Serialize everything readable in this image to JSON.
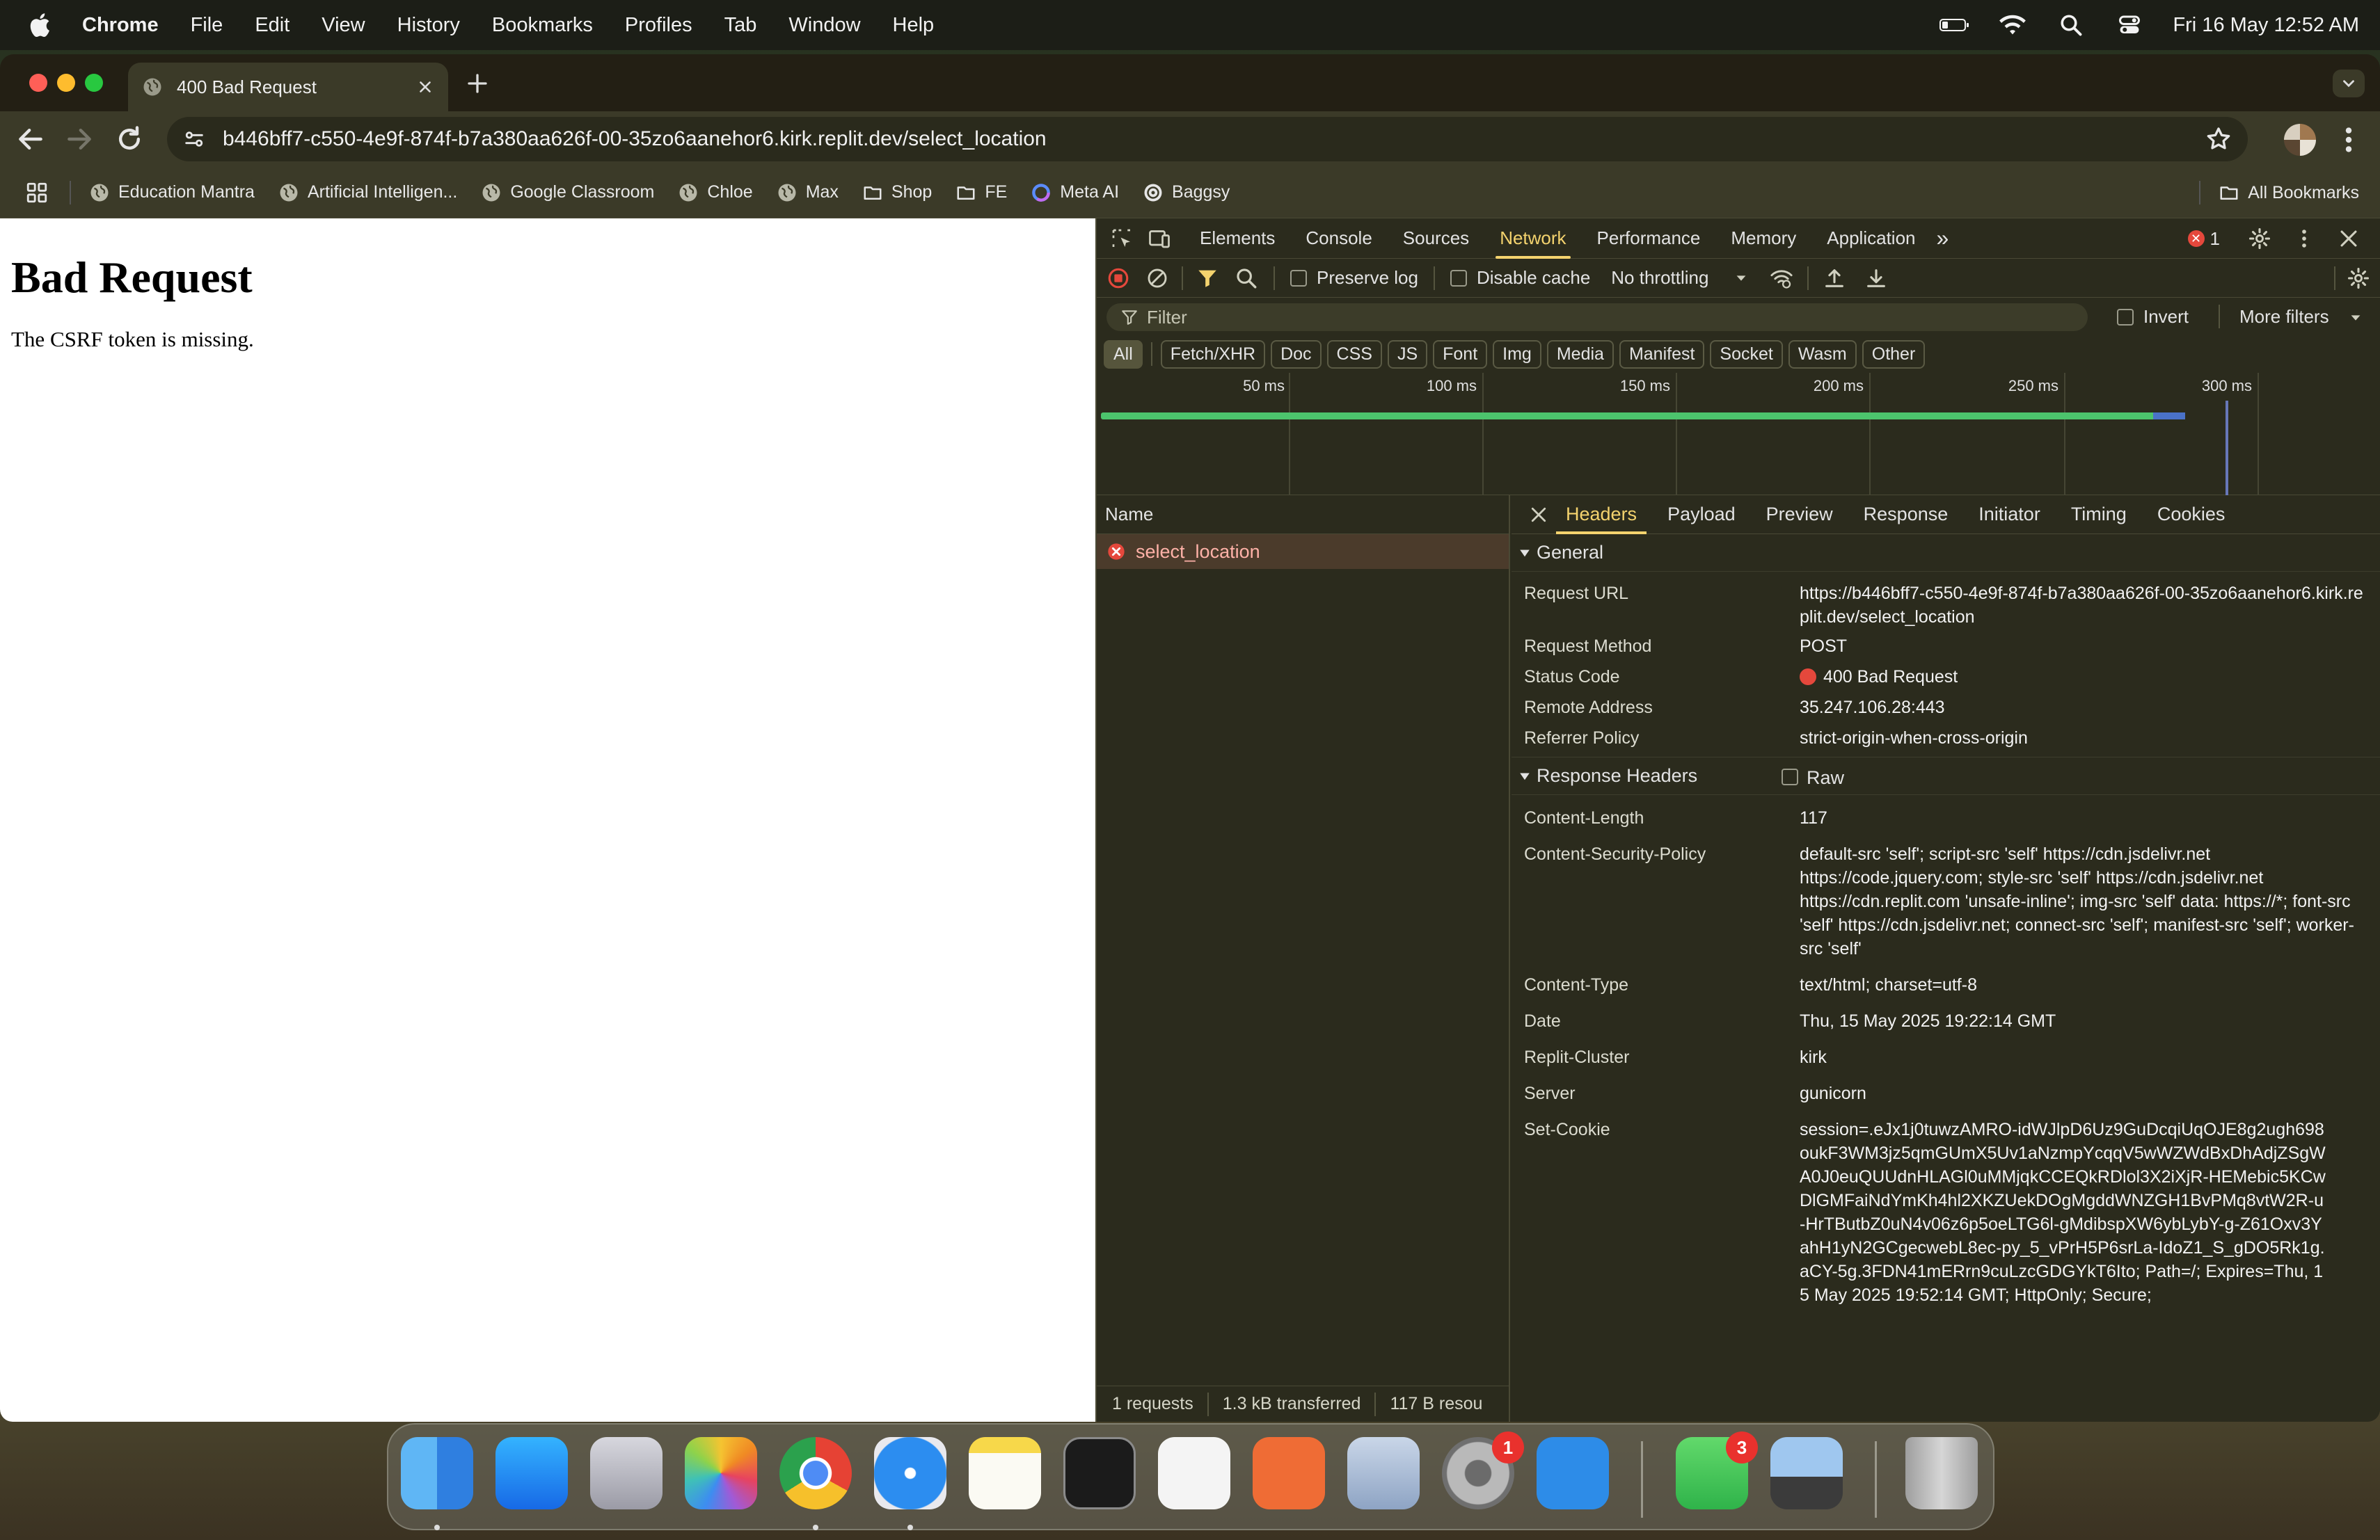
{
  "menubar": {
    "app": "Chrome",
    "items": [
      "File",
      "Edit",
      "View",
      "History",
      "Bookmarks",
      "Profiles",
      "Tab",
      "Window",
      "Help"
    ],
    "clock": "Fri 16 May  12:52 AM"
  },
  "browser": {
    "tab_title": "400 Bad Request",
    "url": "b446bff7-c550-4e9f-874f-b7a380aa626f-00-35zo6aanehor6.kirk.replit.dev/select_location",
    "bookmarks": [
      {
        "label": "Education Mantra",
        "icon": "globe-icon"
      },
      {
        "label": "Artificial Intelligen...",
        "icon": "globe-icon"
      },
      {
        "label": "Google Classroom",
        "icon": "globe-icon"
      },
      {
        "label": "Chloe",
        "icon": "globe-icon"
      },
      {
        "label": "Max",
        "icon": "globe-icon"
      },
      {
        "label": "Shop",
        "icon": "folder-icon"
      },
      {
        "label": "FE",
        "icon": "folder-icon"
      },
      {
        "label": "Meta AI",
        "icon": "meta-ai-icon"
      },
      {
        "label": "Baggsy",
        "icon": "globe-icon"
      }
    ],
    "all_bookmarks": "All Bookmarks"
  },
  "page": {
    "heading": "Bad Request",
    "message": "The CSRF token is missing."
  },
  "devtools": {
    "tabs": [
      "Elements",
      "Console",
      "Sources",
      "Network",
      "Performance",
      "Memory",
      "Application"
    ],
    "active_tab": "Network",
    "more_tabs": "»",
    "error_count": "1",
    "network_toolbar": {
      "preserve_log": "Preserve log",
      "disable_cache": "Disable cache",
      "throttling": "No throttling"
    },
    "filter": {
      "placeholder": "Filter",
      "invert": "Invert",
      "more_filters": "More filters"
    },
    "type_filters": [
      "All",
      "Fetch/XHR",
      "Doc",
      "CSS",
      "JS",
      "Font",
      "Img",
      "Media",
      "Manifest",
      "Socket",
      "Wasm",
      "Other"
    ],
    "timeline": {
      "ticks": [
        "50 ms",
        "100 ms",
        "150 ms",
        "200 ms",
        "250 ms",
        "300 ms"
      ],
      "request_duration_fraction": 0.92
    },
    "requests": {
      "column_name": "Name",
      "rows": [
        {
          "name": "select_location",
          "status": "error"
        }
      ],
      "summary": {
        "requests": "1 requests",
        "transferred": "1.3 kB transferred",
        "resources": "117 B resou"
      }
    },
    "detail_tabs": [
      "Headers",
      "Payload",
      "Preview",
      "Response",
      "Initiator",
      "Timing",
      "Cookies"
    ],
    "general": {
      "title": "General",
      "rows": [
        {
          "key": "Request URL",
          "value": "https://b446bff7-c550-4e9f-874f-b7a380aa626f-00-35zo6aanehor6.kirk.replit.dev/select_location"
        },
        {
          "key": "Request Method",
          "value": "POST"
        },
        {
          "key": "Status Code",
          "value": "400 Bad Request"
        },
        {
          "key": "Remote Address",
          "value": "35.247.106.28:443"
        },
        {
          "key": "Referrer Policy",
          "value": "strict-origin-when-cross-origin"
        }
      ]
    },
    "response_headers": {
      "title": "Response Headers",
      "raw_label": "Raw",
      "rows": [
        {
          "key": "Content-Length",
          "value": "117"
        },
        {
          "key": "Content-Security-Policy",
          "value": "default-src 'self'; script-src 'self' https://cdn.jsdelivr.net https://code.jquery.com; style-src 'self' https://cdn.jsdelivr.net https://cdn.replit.com 'unsafe-inline'; img-src 'self' data: https://*; font-src 'self' https://cdn.jsdelivr.net; connect-src 'self'; manifest-src 'self'; worker-src 'self'"
        },
        {
          "key": "Content-Type",
          "value": "text/html; charset=utf-8"
        },
        {
          "key": "Date",
          "value": "Thu, 15 May 2025 19:22:14 GMT"
        },
        {
          "key": "Replit-Cluster",
          "value": "kirk"
        },
        {
          "key": "Server",
          "value": "gunicorn"
        },
        {
          "key": "Set-Cookie",
          "value": "session=.eJx1j0tuwzAMRO-idWJlpD6Uz9GuDcqiUqOJE8g2ugh698oukF3WM3jz5qmGUmX5Uv1aNzmpYcqqV5wWZWdBxDhAdjZSgWA0J0euQUUdnHLAGl0uMMjqkCCEQkRDlol3X2iXjR-HEMebic5KCwDlGMFaiNdYmKh4hl2XKZUekDOgMgddWNZGH1BvPMq8vtW2R-u-HrTButbZ0uN4v06z6p5oeLTG6l-gMdibspXW6ybLybY-g-Z61Oxv3YahH1yN2GCgecwebL8ec-py_5_vPrH5P6srLa-IdoZ1_S_gDO5Rk1g.aCY-5g.3FDN41mERrn9cuLzcGDGYkT6Ito; Path=/; Expires=Thu, 15 May 2025 19:52:14 GMT; HttpOnly; Secure;"
        }
      ]
    }
  },
  "dock": {
    "apps": [
      "finder-icon",
      "app-store-icon",
      "launchpad-icon",
      "photos-icon",
      "chrome-icon",
      "safari-icon",
      "notes-icon",
      "terminal-icon",
      "vscode-icon",
      "postman-icon",
      "postgres-icon",
      "system-settings-icon",
      "docker-icon",
      "facetime-icon",
      "preview-icon",
      "trash-icon"
    ],
    "system_settings_badge": "1",
    "facetime_badge": "3"
  },
  "colors": {
    "devtools_bg": "#2b2b1d",
    "accent": "#f4d36e",
    "error": "#e5483c",
    "timeline_bar": "#4cc46d"
  }
}
